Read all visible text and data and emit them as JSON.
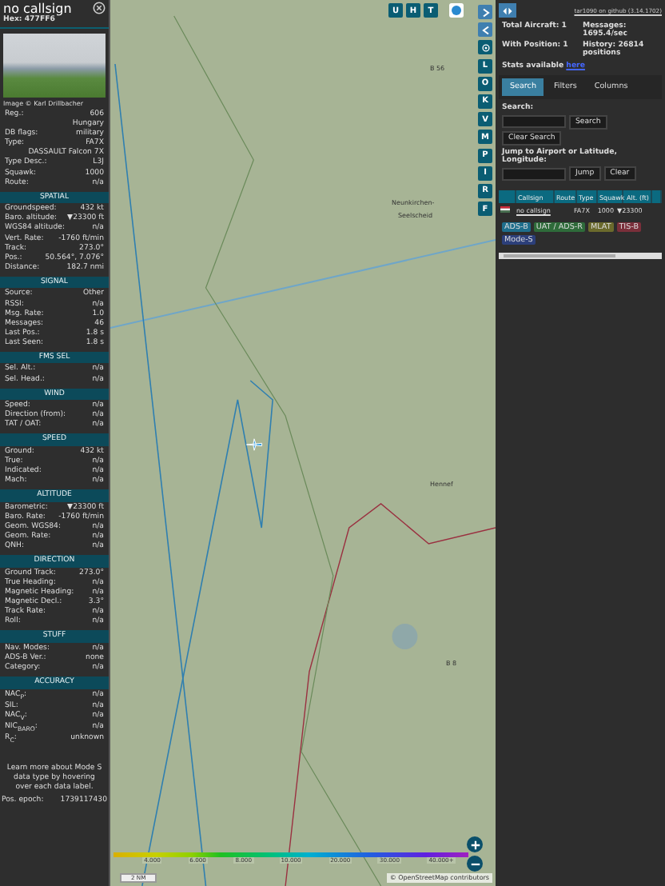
{
  "aircraft": {
    "callsign": "no callsign",
    "hex": "Hex: 477FF6",
    "photo_credit": "Image © Karl Drillbacher",
    "info_rows": [
      {
        "label": "Reg.:",
        "value": "606"
      },
      {
        "value": "Hungary"
      },
      {
        "label": "DB flags:",
        "value": "military"
      },
      {
        "label": "Type:",
        "value": "FA7X"
      },
      {
        "value": "DASSAULT Falcon 7X"
      },
      {
        "label": "Type Desc.:",
        "value": "L3J"
      },
      {
        "label": "Squawk:",
        "value": "1000"
      },
      {
        "label": "Route:",
        "value": "n/a"
      }
    ],
    "sections": [
      {
        "title": "SPATIAL",
        "rows": [
          {
            "label": "Groundspeed:",
            "value": "432 kt"
          },
          {
            "label": "Baro. altitude:",
            "value": "▼23300 ft"
          },
          {
            "label": "WGS84 altitude:",
            "value": "n/a"
          },
          {
            "label": "Vert. Rate:",
            "value": "-1760 ft/min"
          },
          {
            "label": "Track:",
            "value": "273.0°"
          },
          {
            "label": "Pos.:",
            "value": "50.564°, 7.076°"
          },
          {
            "label": "Distance:",
            "value": "182.7 nmi"
          }
        ]
      },
      {
        "title": "SIGNAL",
        "rows": [
          {
            "label": "Source:",
            "value": "Other"
          },
          {
            "label": "RSSI:",
            "value": "n/a"
          },
          {
            "label": "Msg. Rate:",
            "value": "1.0"
          },
          {
            "label": "Messages:",
            "value": "46"
          },
          {
            "label": "Last Pos.:",
            "value": "1.8 s"
          },
          {
            "label": "Last Seen:",
            "value": "1.8 s"
          }
        ]
      },
      {
        "title": "FMS SEL",
        "rows": [
          {
            "label": "Sel. Alt.:",
            "value": "n/a"
          },
          {
            "label": "Sel. Head.:",
            "value": "n/a"
          }
        ]
      },
      {
        "title": "WIND",
        "rows": [
          {
            "label": "Speed:",
            "value": "n/a"
          },
          {
            "label": "Direction (from):",
            "value": "n/a"
          },
          {
            "label": "TAT / OAT:",
            "value": "n/a"
          }
        ]
      },
      {
        "title": "SPEED",
        "rows": [
          {
            "label": "Ground:",
            "value": "432 kt"
          },
          {
            "label": "True:",
            "value": "n/a"
          },
          {
            "label": "Indicated:",
            "value": "n/a"
          },
          {
            "label": "Mach:",
            "value": "n/a"
          }
        ]
      },
      {
        "title": "ALTITUDE",
        "rows": [
          {
            "label": "Barometric:",
            "value": "▼23300 ft"
          },
          {
            "label": "Baro. Rate:",
            "value": "-1760 ft/min"
          },
          {
            "label": "Geom. WGS84:",
            "value": "n/a"
          },
          {
            "label": "Geom. Rate:",
            "value": "n/a"
          },
          {
            "label": "QNH:",
            "value": "n/a"
          }
        ]
      },
      {
        "title": "DIRECTION",
        "rows": [
          {
            "label": "Ground Track:",
            "value": "273.0°"
          },
          {
            "label": "True Heading:",
            "value": "n/a"
          },
          {
            "label": "Magnetic Heading:",
            "value": "n/a"
          },
          {
            "label": "Magnetic Decl.:",
            "value": "3.3°"
          },
          {
            "label": "Track Rate:",
            "value": "n/a"
          },
          {
            "label": "Roll:",
            "value": "n/a"
          }
        ]
      },
      {
        "title": "STUFF",
        "rows": [
          {
            "label": "Nav. Modes:",
            "value": "n/a"
          },
          {
            "label": "ADS-B Ver.:",
            "value": "none"
          },
          {
            "label": "Category:",
            "value": "n/a"
          }
        ]
      },
      {
        "title": "ACCURACY",
        "rows": [
          {
            "label": "NAC$_{P}$:",
            "value": "n/a"
          },
          {
            "label": "SIL:",
            "value": "n/a"
          },
          {
            "label": "NAC$_{V}$:",
            "value": "n/a"
          },
          {
            "label": "NIC$_{BARO}$:",
            "value": "n/a"
          },
          {
            "label": "R$_{C}$:",
            "value": "unknown"
          }
        ]
      }
    ],
    "note": "Learn more about Mode S data type by hovering over each data label.",
    "epoch": {
      "label": "Pos. epoch:",
      "value": "1739117430"
    }
  },
  "map": {
    "top_buttons": [
      "U",
      "H",
      "T"
    ],
    "side_buttons": [
      "L",
      "O",
      "K",
      "V",
      "M",
      "P",
      "I",
      "R",
      "F"
    ],
    "place_labels": [
      "B 56",
      "Neunkirchen-",
      "Seelscheid",
      "Hennef",
      "B 8"
    ],
    "altitude_ticks": [
      "4.000",
      "6.000",
      "8.000",
      "10.000",
      "20.000",
      "30.000",
      "40.000+"
    ],
    "scale": "2 NM",
    "attribution": "© OpenStreetMap contributors"
  },
  "side": {
    "version_link": "tar1090 on github (3.14.1702)",
    "stats": [
      {
        "label": "Total Aircraft: 1"
      },
      {
        "label": "Messages: 1695.4/sec"
      },
      {
        "label": "With Position: 1"
      },
      {
        "label": "History: 26814 positions"
      }
    ],
    "stats_text": "Stats available",
    "stats_link": "here",
    "tabs": [
      {
        "label": "Search",
        "selected": true
      },
      {
        "label": "Filters",
        "selected": false
      },
      {
        "label": "Columns",
        "selected": false
      }
    ],
    "search_label": "Search:",
    "search_button": "Search",
    "clear_search_button": "Clear Search",
    "jump_label": "Jump to Airport or Latitude, Longitude:",
    "jump_button": "Jump",
    "clear_button": "Clear",
    "table": {
      "columns": [
        "Callsign",
        "Route",
        "Type",
        "Squawk",
        "Alt. (ft)"
      ],
      "rows": [
        {
          "callsign": "no callsign",
          "type": "FA7X",
          "squawk": "1000",
          "altitude": "▼23300"
        }
      ]
    },
    "legend": [
      {
        "label": "ADS-B",
        "color": "#1e6e8c"
      },
      {
        "label": "UAT / ADS-R",
        "color": "#2e6b3a"
      },
      {
        "label": "MLAT",
        "color": "#6b6a2c"
      },
      {
        "label": "TIS-B",
        "color": "#7a2f3a"
      },
      {
        "label": "Mode-S",
        "color": "#2c3f7a"
      }
    ]
  }
}
